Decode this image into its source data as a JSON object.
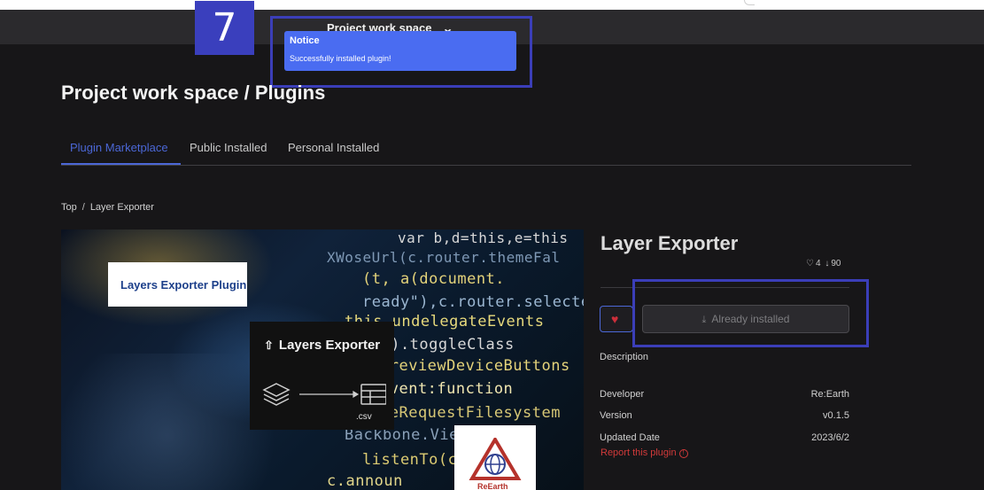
{
  "annotation": {
    "step_number": "7"
  },
  "header": {
    "project_name": "Project work space",
    "chevron_icon": "chevron-down-icon"
  },
  "notice": {
    "title": "Notice",
    "message": "Successfully installed plugin!"
  },
  "page": {
    "title": "Project work space / Plugins"
  },
  "tabs": [
    {
      "label": "Plugin Marketplace",
      "active": true
    },
    {
      "label": "Public Installed",
      "active": false
    },
    {
      "label": "Personal Installed",
      "active": false
    }
  ],
  "breadcrumb": {
    "root": "Top",
    "separator": "/",
    "current": "Layer Exporter"
  },
  "hero": {
    "card_label": "Layers Exporter Plugin",
    "export_title": "Layers Exporter",
    "csv_label": ".csv",
    "logo_text": "ReEarth",
    "code_lines": [
      "var b,d=this,e=this",
      "XWoseUrl(c.router.themeFal",
      "(t, a(document.",
      "ready\"),c.router.selectedT",
      "this.undelegateEvents",
      "ed\").toggleClass",
      "PreviewDeviceButtons",
      "event:function",
      "peRequestFilesystem",
      "Backbone.View.",
      "listenTo(c.collec",
      "c.announ"
    ]
  },
  "plugin": {
    "name": "Layer Exporter",
    "likes": "4",
    "downloads": "90",
    "install_label": "Already installed",
    "description_label": "Description",
    "details": [
      {
        "key": "Developer",
        "value": "Re:Earth"
      },
      {
        "key": "Version",
        "value": "v0.1.5"
      },
      {
        "key": "Updated Date",
        "value": "2023/6/2"
      }
    ],
    "report_label": "Report this plugin"
  },
  "colors": {
    "accent": "#4b67d6",
    "notice_bg": "#4a6cf1",
    "annotation": "#3b3eb8",
    "danger": "#d23a3a",
    "background": "#171618"
  }
}
